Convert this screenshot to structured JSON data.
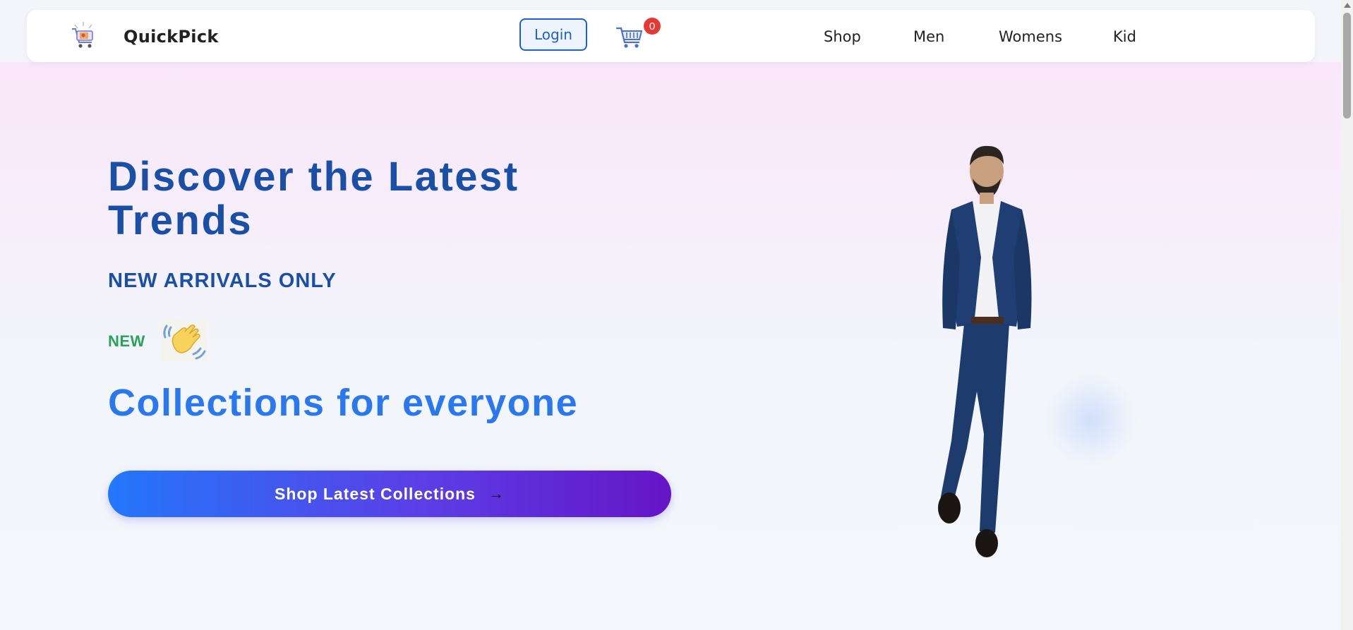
{
  "navbar": {
    "brand": "QuickPick",
    "login_label": "Login",
    "cart_count": "0",
    "links": [
      "Shop",
      "Men",
      "Womens",
      "Kid"
    ]
  },
  "hero": {
    "title": "Discover the Latest Trends",
    "subtitle": "NEW ARRIVALS ONLY",
    "new_label": "NEW",
    "tagline": "Collections for everyone",
    "cta_label": "Shop Latest Collections",
    "cta_arrow": "→"
  },
  "icons": {
    "logo": "shopping-cart-logo-icon",
    "cart": "cart-icon",
    "wave": "waving-hand-icon",
    "arrow": "arrow-right-icon"
  },
  "colors": {
    "primary": "#1a4fa8",
    "accent": "#2a78ef",
    "new_green": "#27a35b",
    "badge_red": "#e53935",
    "cta_start": "#2377fa",
    "cta_end": "#6515c7"
  }
}
